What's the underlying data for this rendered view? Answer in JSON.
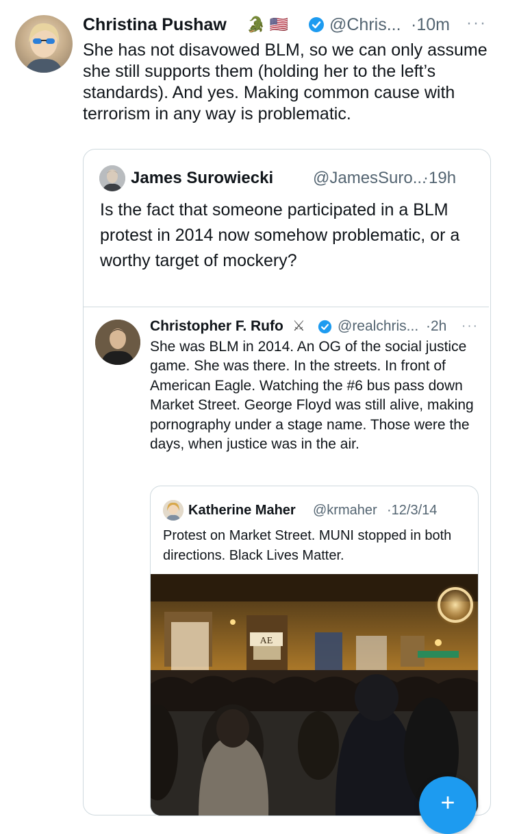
{
  "main_tweet": {
    "name": "Christina Pushaw",
    "name_emojis": "🐊 🇺🇸",
    "handle": "@Chris...",
    "time": "·10m",
    "text": "She has not disavowed BLM, so we can only assume she still supports them (holding her to the left’s standards). And yes. Making common cause with terrorism in any way is problematic."
  },
  "quote_1": {
    "name": "James Surowiecki",
    "handle": "@JamesSuro...",
    "time": "·19h",
    "text": "Is the fact that someone participated in a BLM protest in 2014 now somehow problematic, or a worthy target of mockery?"
  },
  "quote_2": {
    "name": "Christopher F. Rufo",
    "name_emoji": "⚔",
    "handle": "@realchris...",
    "time": "·2h",
    "text": "She was BLM in 2014. An OG of the social justice game. She was there. In the streets. In front of American Eagle. Watching the #6 bus pass down Market Street. George Floyd was still alive, making pornography under a stage name. Those were the days, when justice was in the air."
  },
  "quote_3": {
    "name": "Katherine Maher",
    "handle": "@krmaher",
    "time": "·12/3/14",
    "text": "Protest on Market Street. MUNI stopped in both directions. Black Lives Matter.",
    "photo_sign": "AE"
  },
  "more_menu": "···",
  "fab_symbol": "+",
  "colors": {
    "verified_blue": "#1d9bf0",
    "text": "#0f1419",
    "secondary": "#536471",
    "border": "#cfd9de"
  },
  "icons": [
    "more-icon",
    "verified-badge-icon",
    "compose-plus-icon"
  ]
}
